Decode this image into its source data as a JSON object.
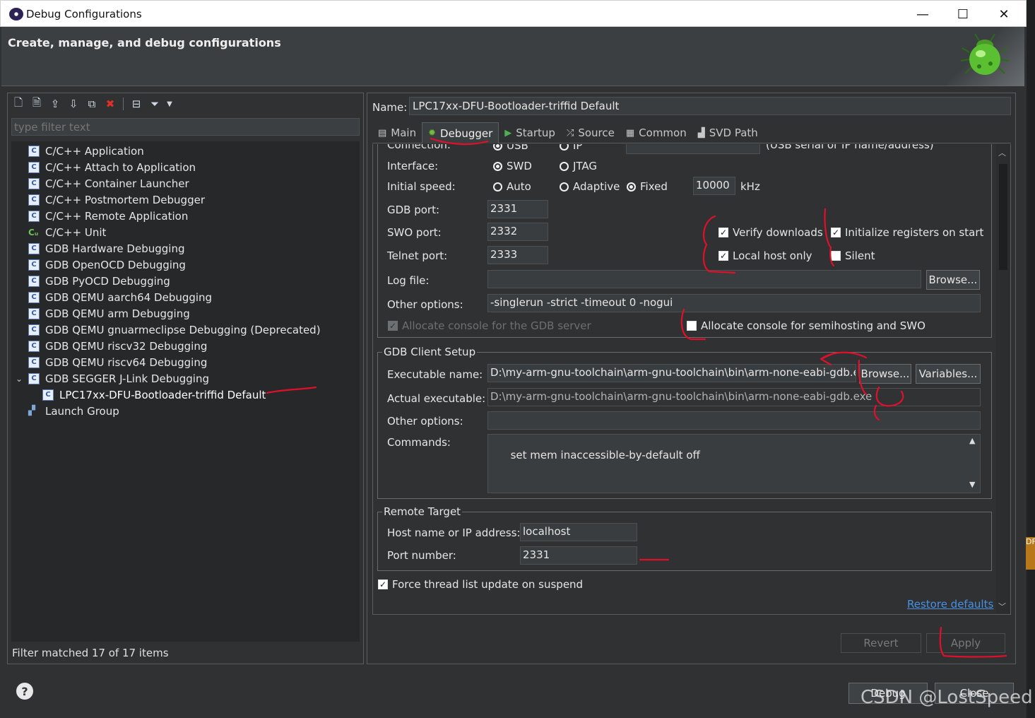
{
  "window": {
    "title": "Debug Configurations",
    "minimize": "—",
    "maximize": "☐",
    "close": "✕"
  },
  "header": {
    "title": "Create, manage, and debug configurations"
  },
  "left": {
    "filter_placeholder": "type filter text",
    "tree": [
      {
        "label": "C/C++ Application",
        "icon": "c-config-icon"
      },
      {
        "label": "C/C++ Attach to Application",
        "icon": "c-config-icon"
      },
      {
        "label": "C/C++ Container Launcher",
        "icon": "c-config-icon"
      },
      {
        "label": "C/C++ Postmortem Debugger",
        "icon": "c-config-icon"
      },
      {
        "label": "C/C++ Remote Application",
        "icon": "c-config-icon"
      },
      {
        "label": "C/C++ Unit",
        "icon": "unit-test-icon"
      },
      {
        "label": "GDB Hardware Debugging",
        "icon": "c-config-icon"
      },
      {
        "label": "GDB OpenOCD Debugging",
        "icon": "c-config-icon"
      },
      {
        "label": "GDB PyOCD Debugging",
        "icon": "c-config-icon"
      },
      {
        "label": "GDB QEMU aarch64 Debugging",
        "icon": "c-config-icon"
      },
      {
        "label": "GDB QEMU arm Debugging",
        "icon": "c-config-icon"
      },
      {
        "label": "GDB QEMU gnuarmeclipse Debugging (Deprecated)",
        "icon": "c-config-icon"
      },
      {
        "label": "GDB QEMU riscv32 Debugging",
        "icon": "c-config-icon"
      },
      {
        "label": "GDB QEMU riscv64 Debugging",
        "icon": "c-config-icon"
      },
      {
        "label": "GDB SEGGER J-Link Debugging",
        "icon": "c-config-icon",
        "expanded": true
      },
      {
        "label": "LPC17xx-DFU-Bootloader-triffid Default",
        "icon": "c-config-icon",
        "child": true,
        "selected": true
      },
      {
        "label": "Launch Group",
        "icon": "launch-group-icon"
      }
    ],
    "status": "Filter matched 17 of 17 items"
  },
  "config": {
    "name_label": "Name:",
    "name_value": "LPC17xx-DFU-Bootloader-triffid Default",
    "tabs": [
      {
        "label": "Main",
        "icon": "▤"
      },
      {
        "label": "Debugger",
        "icon": "✹",
        "active": true
      },
      {
        "label": "Startup",
        "icon": "▶"
      },
      {
        "label": "Source",
        "icon": "⤮"
      },
      {
        "label": "Common",
        "icon": "▦"
      },
      {
        "label": "SVD Path",
        "icon": "▟"
      }
    ]
  },
  "server": {
    "connection_label": "Connection:",
    "conn_usb": "USB",
    "conn_ip": "IP",
    "conn_hint": "(USB serial or IP name/address)",
    "interface_label": "Interface:",
    "iface_swd": "SWD",
    "iface_jtag": "JTAG",
    "speed_label": "Initial speed:",
    "speed_auto": "Auto",
    "speed_adaptive": "Adaptive",
    "speed_fixed": "Fixed",
    "speed_value": "10000",
    "speed_unit": "kHz",
    "gdb_port_label": "GDB port:",
    "gdb_port": "2331",
    "swo_port_label": "SWO port:",
    "swo_port": "2332",
    "telnet_port_label": "Telnet port:",
    "telnet_port": "2333",
    "verify_downloads": "Verify downloads",
    "init_registers": "Initialize registers on start",
    "local_host_only": "Local host only",
    "silent": "Silent",
    "log_file_label": "Log file:",
    "log_file": "",
    "browse": "Browse...",
    "other_options_label": "Other options:",
    "other_options": "-singlerun -strict -timeout 0 -nogui",
    "allocate_gdb_console": "Allocate console for the GDB server",
    "allocate_semihosting": "Allocate console for semihosting and SWO"
  },
  "client": {
    "group_title": "GDB Client Setup",
    "exe_label": "Executable name:",
    "exe_value": "D:\\my-arm-gnu-toolchain\\arm-gnu-toolchain\\bin\\arm-none-eabi-gdb.exe",
    "browse": "Browse...",
    "variables": "Variables...",
    "actual_label": "Actual executable:",
    "actual_value": "D:\\my-arm-gnu-toolchain\\arm-gnu-toolchain\\bin\\arm-none-eabi-gdb.exe",
    "other_label": "Other options:",
    "other_value": "",
    "commands_label": "Commands:",
    "commands_value": "set mem inaccessible-by-default off"
  },
  "remote": {
    "group_title": "Remote Target",
    "host_label": "Host name or IP address:",
    "host_value": "localhost",
    "port_label": "Port number:",
    "port_value": "2331"
  },
  "force_thread": "Force thread list update on suspend",
  "restore_defaults": "Restore defaults",
  "revert": "Revert",
  "apply": "Apply",
  "debug": "Debug",
  "close": "Close",
  "help": "?",
  "watermark": "CSDN @LostSpeed",
  "edge_tab": "DF",
  "colors": {
    "accent_link": "#4a90e2",
    "annotation": "#e0102a",
    "background": "#2f3133"
  }
}
